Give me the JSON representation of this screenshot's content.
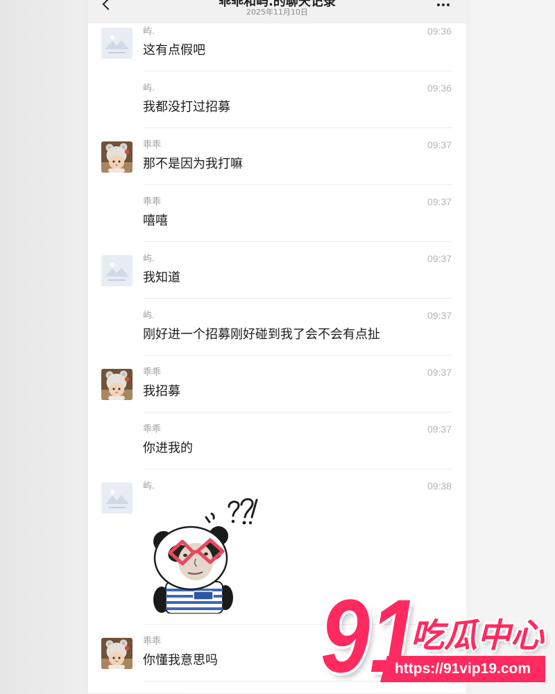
{
  "header": {
    "title": "乖乖和屿.的聊天记录",
    "date": "2025年11月10日",
    "back_icon": "chevron-left-icon",
    "more_icon": "more-horizontal-icon"
  },
  "messages": [
    {
      "sender": "屿.",
      "time": "09:36",
      "text": "这有点假吧",
      "avatar": "image-placeholder"
    },
    {
      "sender": "屿.",
      "time": "09:36",
      "text": "我都没打过招募",
      "avatar": null
    },
    {
      "sender": "乖乖",
      "time": "09:37",
      "text": "那不是因为我打嘛",
      "avatar": "cartoon-bear-hood"
    },
    {
      "sender": "乖乖",
      "time": "09:37",
      "text": "嘻嘻",
      "avatar": null
    },
    {
      "sender": "屿.",
      "time": "09:37",
      "text": "我知道",
      "avatar": "image-placeholder"
    },
    {
      "sender": "屿.",
      "time": "09:37",
      "text": "刚好进一个招募刚好碰到我了会不会有点扯",
      "avatar": null
    },
    {
      "sender": "乖乖",
      "time": "09:37",
      "text": "我招募",
      "avatar": "cartoon-bear-hood"
    },
    {
      "sender": "乖乖",
      "time": "09:37",
      "text": "你进我的",
      "avatar": null
    },
    {
      "sender": "屿.",
      "time": "09:38",
      "sticker": "panda-question-sticker",
      "avatar": "image-placeholder"
    },
    {
      "sender": "乖乖",
      "text": "你懂我意思吗",
      "avatar": "cartoon-bear-hood"
    }
  ],
  "watermark": {
    "number": "91",
    "name": "吃瓜中心",
    "url": "https://91vip19.com"
  },
  "colors": {
    "page_bg": "#f0f0f0",
    "panel_bg": "#ffffff",
    "header_bg": "#f1f1f1",
    "text": "#1b1b1b",
    "sender": "#9b9b9b",
    "time": "#b5b5b5",
    "divider": "#ececec",
    "watermark": "#ff2a5f"
  }
}
